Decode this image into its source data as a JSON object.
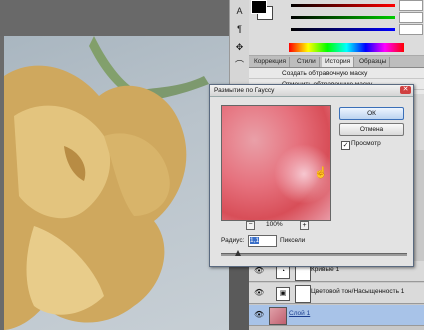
{
  "dialog": {
    "title": "Размытие по Гауссу",
    "ok_label": "ОК",
    "cancel_label": "Отмена",
    "preview_label": "Просмотр",
    "preview_checked": "✓",
    "zoom": "100%",
    "zoom_minus": "−",
    "zoom_plus": "+",
    "radius_label": "Радиус:",
    "radius_value": "1,1",
    "units_label": "Пиксели",
    "radius_slider_level": 0.09
  },
  "panel_tabs": [
    "Коррекция",
    "Стили",
    "История",
    "Образцы"
  ],
  "history": [
    "Создать обтравочную маску",
    "Отменить обтравочную маску"
  ],
  "layers": [
    {
      "name": "Кривые 1",
      "selected": false
    },
    {
      "name": "Цветовой тон/Насыщенность 1",
      "selected": false
    },
    {
      "name": "Слой 1",
      "selected": true
    }
  ],
  "tools": [
    "A",
    "¶",
    "✥",
    "⌒"
  ],
  "colors": {
    "fg": "#000000",
    "bg": "#ffffff",
    "accent": "#3a6fb8"
  }
}
